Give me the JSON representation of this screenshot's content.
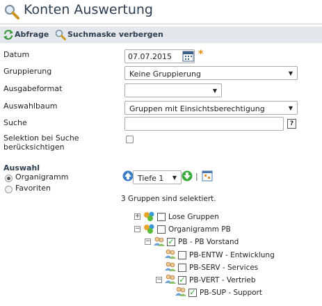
{
  "page": {
    "title": "Konten Auswertung"
  },
  "toolbar": {
    "query_label": "Abfrage",
    "toggle_search_label": "Suchmaske verbergen"
  },
  "form": {
    "date": {
      "label": "Datum",
      "value": "07.07.2015",
      "required_mark": "*"
    },
    "grouping": {
      "label": "Gruppierung",
      "value": "Keine Gruppierung"
    },
    "output_format": {
      "label": "Ausgabeformat",
      "value": ""
    },
    "selection_tree": {
      "label": "Auswahlbaum",
      "value": "Gruppen mit Einsichtsberechtigung"
    },
    "search": {
      "label": "Suche",
      "value": "",
      "help": "?"
    },
    "consider_selection": {
      "label_line1": "Selektion bei Suche",
      "label_line2": "berücksichtigen",
      "checked": false
    }
  },
  "selection": {
    "heading": "Auswahl",
    "options": [
      {
        "label": "Organigramm",
        "selected": true
      },
      {
        "label": "Favoriten",
        "selected": false
      }
    ],
    "depth": {
      "value": "Tiefe 1"
    },
    "separator": "|",
    "status": "3 Gruppen sind selektiert."
  },
  "tree": [
    {
      "label": "Lose Gruppen",
      "checked": false,
      "expander": "+"
    },
    {
      "label": "Organigramm PB",
      "checked": false,
      "expander": "−"
    },
    {
      "label": "PB - PB Vorstand",
      "checked": true,
      "expander": "−"
    },
    {
      "label": "PB-ENTW - Entwicklung",
      "checked": false,
      "expander": ""
    },
    {
      "label": "PB-SERV - Services",
      "checked": false,
      "expander": ""
    },
    {
      "label": "PB-VERT - Vertrieb",
      "checked": true,
      "expander": "−"
    },
    {
      "label": "PB-SUP - Support",
      "checked": true,
      "expander": ""
    }
  ],
  "colors": {
    "accent": "#2d3d50",
    "toolbar_bg": "#e4e8ec",
    "required": "#e48b00",
    "check": "#2aa42a"
  }
}
